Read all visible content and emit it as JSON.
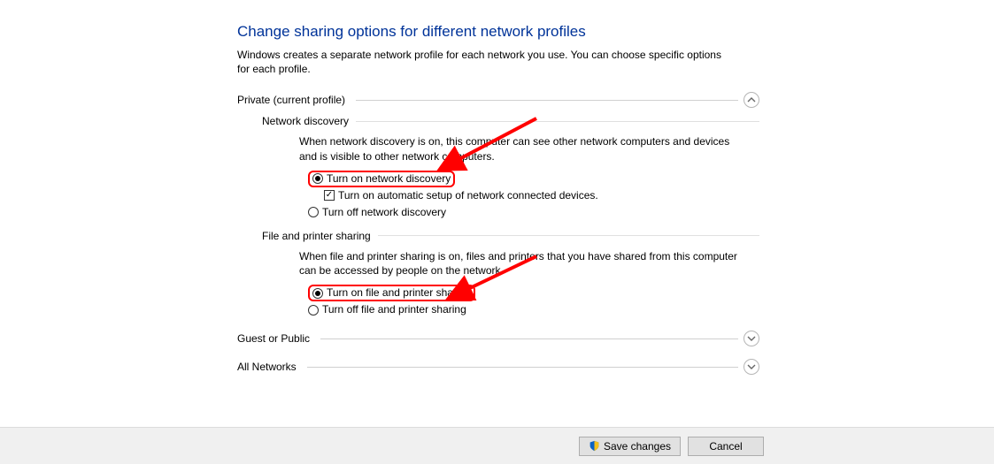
{
  "page": {
    "title": "Change sharing options for different network profiles",
    "description": "Windows creates a separate network profile for each network you use. You can choose specific options for each profile."
  },
  "sections": {
    "private": {
      "label": "Private (current profile)",
      "expanded": true,
      "network_discovery": {
        "heading": "Network discovery",
        "description": "When network discovery is on, this computer can see other network computers and devices and is visible to other network computers.",
        "opt_on": "Turn on network discovery",
        "opt_auto": "Turn on automatic setup of network connected devices.",
        "opt_off": "Turn off network discovery",
        "selected": "on",
        "auto_checked": true
      },
      "file_printer": {
        "heading": "File and printer sharing",
        "description": "When file and printer sharing is on, files and printers that you have shared from this computer can be accessed by people on the network.",
        "opt_on": "Turn on file and printer sharing",
        "opt_off": "Turn off file and printer sharing",
        "selected": "on"
      }
    },
    "guest": {
      "label": "Guest or Public",
      "expanded": false
    },
    "all": {
      "label": "All Networks",
      "expanded": false
    }
  },
  "buttons": {
    "save": "Save changes",
    "cancel": "Cancel"
  },
  "annotations": {
    "highlight_color": "#ff0000"
  }
}
